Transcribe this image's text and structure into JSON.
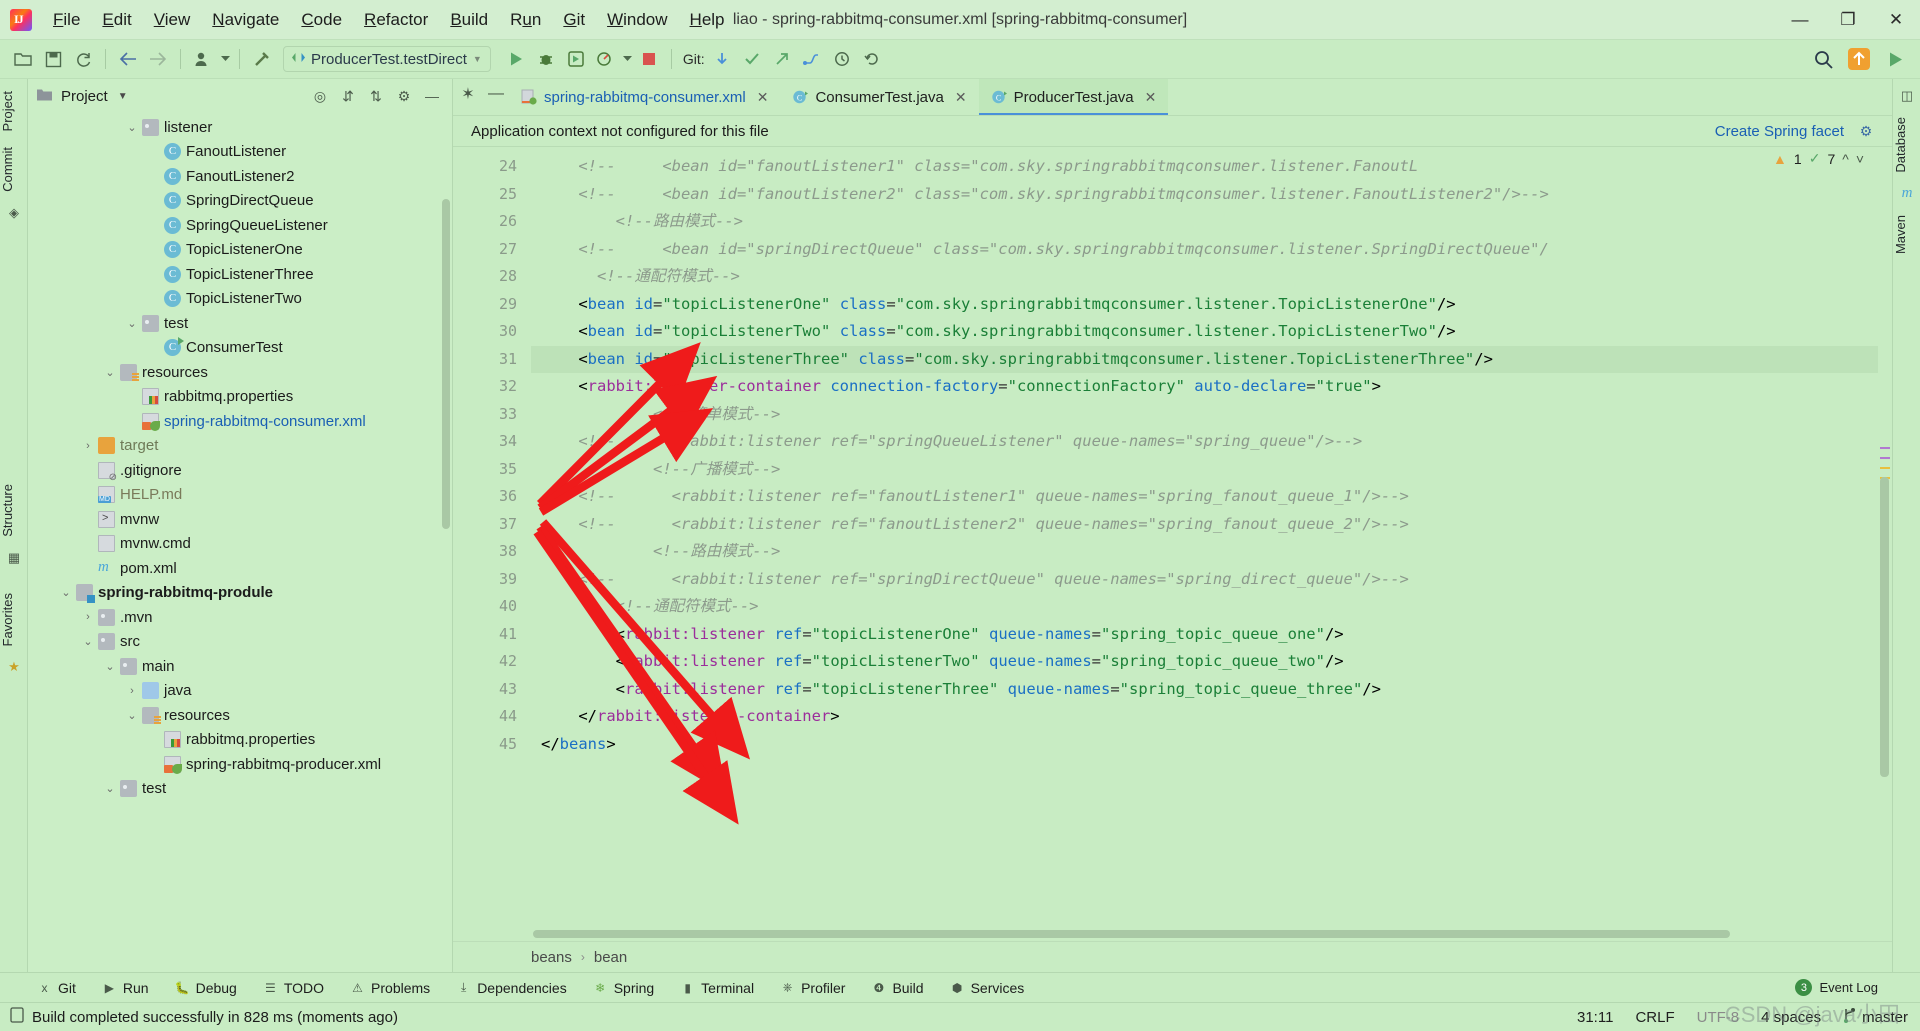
{
  "window": {
    "title": "liao - spring-rabbitmq-consumer.xml [spring-rabbitmq-consumer]",
    "minimize": "—",
    "maximize": "❐",
    "close": "✕"
  },
  "menubar": {
    "items": [
      "File",
      "Edit",
      "View",
      "Navigate",
      "Code",
      "Refactor",
      "Build",
      "Run",
      "Git",
      "Window",
      "Help"
    ]
  },
  "toolbar": {
    "run_config": "ProducerTest.testDirect",
    "git_label": "Git:"
  },
  "left_strip": {
    "tabs": [
      "Project",
      "Commit",
      "Structure",
      "Favorites"
    ]
  },
  "right_strip": {
    "tabs": [
      "Database",
      "Maven"
    ]
  },
  "project_panel": {
    "title": "Project",
    "tree": [
      {
        "indent": 4,
        "twisty": "⌄",
        "icon": "folder",
        "label": "listener",
        "style": ""
      },
      {
        "indent": 5,
        "twisty": "",
        "icon": "cls",
        "label": "FanoutListener",
        "style": ""
      },
      {
        "indent": 5,
        "twisty": "",
        "icon": "cls",
        "label": "FanoutListener2",
        "style": ""
      },
      {
        "indent": 5,
        "twisty": "",
        "icon": "cls",
        "label": "SpringDirectQueue",
        "style": ""
      },
      {
        "indent": 5,
        "twisty": "",
        "icon": "cls",
        "label": "SpringQueueListener",
        "style": ""
      },
      {
        "indent": 5,
        "twisty": "",
        "icon": "cls",
        "label": "TopicListenerOne",
        "style": ""
      },
      {
        "indent": 5,
        "twisty": "",
        "icon": "cls",
        "label": "TopicListenerThree",
        "style": ""
      },
      {
        "indent": 5,
        "twisty": "",
        "icon": "cls",
        "label": "TopicListenerTwo",
        "style": ""
      },
      {
        "indent": 4,
        "twisty": "⌄",
        "icon": "folder",
        "label": "test",
        "style": ""
      },
      {
        "indent": 5,
        "twisty": "",
        "icon": "cls-run",
        "label": "ConsumerTest",
        "style": ""
      },
      {
        "indent": 3,
        "twisty": "⌄",
        "icon": "folder-src",
        "label": "resources",
        "style": ""
      },
      {
        "indent": 4,
        "twisty": "",
        "icon": "props",
        "label": "rabbitmq.properties",
        "style": ""
      },
      {
        "indent": 4,
        "twisty": "",
        "icon": "spring",
        "label": "spring-rabbitmq-consumer.xml",
        "style": "sel"
      },
      {
        "indent": 2,
        "twisty": "›",
        "icon": "folder-orange",
        "label": "target",
        "style": "dim"
      },
      {
        "indent": 2,
        "twisty": "",
        "icon": "git",
        "label": ".gitignore",
        "style": ""
      },
      {
        "indent": 2,
        "twisty": "",
        "icon": "md",
        "label": "HELP.md",
        "style": "dim2"
      },
      {
        "indent": 2,
        "twisty": "",
        "icon": "sh",
        "label": "mvnw",
        "style": ""
      },
      {
        "indent": 2,
        "twisty": "",
        "icon": "file",
        "label": "mvnw.cmd",
        "style": ""
      },
      {
        "indent": 2,
        "twisty": "",
        "icon": "mvn",
        "label": "pom.xml",
        "style": ""
      },
      {
        "indent": 1,
        "twisty": "⌄",
        "icon": "mod",
        "label": "spring-rabbitmq-produle",
        "style": "bold"
      },
      {
        "indent": 2,
        "twisty": "›",
        "icon": "folder",
        "label": ".mvn",
        "style": ""
      },
      {
        "indent": 2,
        "twisty": "⌄",
        "icon": "folder",
        "label": "src",
        "style": ""
      },
      {
        "indent": 3,
        "twisty": "⌄",
        "icon": "folder",
        "label": "main",
        "style": ""
      },
      {
        "indent": 4,
        "twisty": "›",
        "icon": "folder-blue",
        "label": "java",
        "style": ""
      },
      {
        "indent": 4,
        "twisty": "⌄",
        "icon": "folder-src",
        "label": "resources",
        "style": ""
      },
      {
        "indent": 5,
        "twisty": "",
        "icon": "props",
        "label": "rabbitmq.properties",
        "style": ""
      },
      {
        "indent": 5,
        "twisty": "",
        "icon": "spring",
        "label": "spring-rabbitmq-producer.xml",
        "style": ""
      },
      {
        "indent": 3,
        "twisty": "⌄",
        "icon": "folder",
        "label": "test",
        "style": ""
      }
    ]
  },
  "editor": {
    "tabs": [
      {
        "label": "spring-rabbitmq-consumer.xml",
        "icon": "spring",
        "active": true,
        "style": "blue"
      },
      {
        "label": "ConsumerTest.java",
        "icon": "cls-run",
        "active": false,
        "style": ""
      },
      {
        "label": "ProducerTest.java",
        "icon": "cls-run",
        "active": true,
        "style": ""
      }
    ],
    "close_glyph": "✕",
    "notification": "Application context not configured for this file",
    "create_facet_link": "Create Spring facet",
    "inspection_warn_count": "1",
    "inspection_ok_count": "7",
    "breadcrumb": [
      "beans",
      "bean"
    ],
    "first_line_number": 24,
    "lines": [
      {
        "n": 24,
        "fold": "",
        "hl": false,
        "tokens": [
          {
            "t": "cmt",
            "v": "    <!--     <bean id=\"fanoutListener1\" class=\"com.sky.springrabbitmqconsumer.listener.FanoutL"
          }
        ]
      },
      {
        "n": 25,
        "fold": "▸",
        "hl": false,
        "tokens": [
          {
            "t": "cmt",
            "v": "    <!--     <bean id=\"fanoutListener2\" class=\"com.sky.springrabbitmqconsumer.listener.FanoutListener2\"/>-->"
          }
        ]
      },
      {
        "n": 26,
        "fold": "",
        "hl": false,
        "tokens": [
          {
            "t": "cmt",
            "v": "        <!--路由模式-->"
          }
        ]
      },
      {
        "n": 27,
        "fold": "▸",
        "hl": false,
        "tokens": [
          {
            "t": "cmt",
            "v": "    <!--     <bean id=\"springDirectQueue\" class=\"com.sky.springrabbitmqconsumer.listener.SpringDirectQueue\"/"
          }
        ]
      },
      {
        "n": 28,
        "fold": "",
        "hl": false,
        "tokens": [
          {
            "t": "cmt",
            "v": "      <!--通配符模式-->"
          }
        ]
      },
      {
        "n": 29,
        "fold": "",
        "hl": false,
        "tokens": [
          {
            "t": "tag",
            "v": "    <"
          },
          {
            "t": "tagname",
            "v": "bean"
          },
          {
            "t": "plain",
            "v": " "
          },
          {
            "t": "attr",
            "v": "id"
          },
          {
            "t": "eq",
            "v": "="
          },
          {
            "t": "str",
            "v": "\"topicListenerOne\""
          },
          {
            "t": "plain",
            "v": " "
          },
          {
            "t": "attr",
            "v": "class"
          },
          {
            "t": "eq",
            "v": "="
          },
          {
            "t": "str",
            "v": "\"com.sky.springrabbitmqconsumer.listener.TopicListenerOne\""
          },
          {
            "t": "tag",
            "v": "/>"
          }
        ]
      },
      {
        "n": 30,
        "fold": "",
        "hl": false,
        "tokens": [
          {
            "t": "tag",
            "v": "    <"
          },
          {
            "t": "tagname",
            "v": "bean"
          },
          {
            "t": "plain",
            "v": " "
          },
          {
            "t": "attr",
            "v": "id"
          },
          {
            "t": "eq",
            "v": "="
          },
          {
            "t": "str",
            "v": "\"topicListenerTwo\""
          },
          {
            "t": "plain",
            "v": " "
          },
          {
            "t": "attr",
            "v": "class"
          },
          {
            "t": "eq",
            "v": "="
          },
          {
            "t": "str",
            "v": "\"com.sky.springrabbitmqconsumer.listener.TopicListenerTwo\""
          },
          {
            "t": "tag",
            "v": "/>"
          }
        ]
      },
      {
        "n": 31,
        "fold": "",
        "hl": true,
        "tokens": [
          {
            "t": "tag",
            "v": "    <"
          },
          {
            "t": "tagname",
            "v": "bean"
          },
          {
            "t": "plain",
            "v": " "
          },
          {
            "t": "attr",
            "v": "id"
          },
          {
            "t": "eq",
            "v": "="
          },
          {
            "t": "str",
            "v": "\"topicListenerThree\""
          },
          {
            "t": "plain",
            "v": " "
          },
          {
            "t": "attr",
            "v": "class"
          },
          {
            "t": "eq",
            "v": "="
          },
          {
            "t": "str",
            "v": "\"com.sky.springrabbitmqconsumer.listener.TopicListenerThree\""
          },
          {
            "t": "tag",
            "v": "/>"
          }
        ]
      },
      {
        "n": 32,
        "fold": "",
        "hl": false,
        "tokens": [
          {
            "t": "tag",
            "v": "    <"
          },
          {
            "t": "tagname-ns",
            "v": "rabbit:listener-container"
          },
          {
            "t": "plain",
            "v": " "
          },
          {
            "t": "attr",
            "v": "connection-factory"
          },
          {
            "t": "eq",
            "v": "="
          },
          {
            "t": "str",
            "v": "\"connectionFactory\""
          },
          {
            "t": "plain",
            "v": " "
          },
          {
            "t": "attr",
            "v": "auto-declare"
          },
          {
            "t": "eq",
            "v": "="
          },
          {
            "t": "str",
            "v": "\"true\""
          },
          {
            "t": "tag",
            "v": ">"
          }
        ]
      },
      {
        "n": 33,
        "fold": "",
        "hl": false,
        "tokens": [
          {
            "t": "cmt",
            "v": "            <!--简单模式-->"
          }
        ]
      },
      {
        "n": 34,
        "fold": "▸",
        "hl": false,
        "tokens": [
          {
            "t": "cmt",
            "v": "    <!--      <rabbit:listener ref=\"springQueueListener\" queue-names=\"spring_queue\"/>-->"
          }
        ]
      },
      {
        "n": 35,
        "fold": "",
        "hl": false,
        "tokens": [
          {
            "t": "cmt",
            "v": "            <!--广播模式-->"
          }
        ]
      },
      {
        "n": 36,
        "fold": "",
        "hl": false,
        "tokens": [
          {
            "t": "cmt",
            "v": "    <!--      <rabbit:listener ref=\"fanoutListener1\" queue-names=\"spring_fanout_queue_1\"/>-->"
          }
        ]
      },
      {
        "n": 37,
        "fold": "",
        "hl": false,
        "tokens": [
          {
            "t": "cmt",
            "v": "    <!--      <rabbit:listener ref=\"fanoutListener2\" queue-names=\"spring_fanout_queue_2\"/>-->"
          }
        ]
      },
      {
        "n": 38,
        "fold": "",
        "hl": false,
        "tokens": [
          {
            "t": "cmt",
            "v": "            <!--路由模式-->"
          }
        ]
      },
      {
        "n": 39,
        "fold": "▸",
        "hl": false,
        "tokens": [
          {
            "t": "cmt",
            "v": "    <!--      <rabbit:listener ref=\"springDirectQueue\" queue-names=\"spring_direct_queue\"/>-->"
          }
        ]
      },
      {
        "n": 40,
        "fold": "",
        "hl": false,
        "tokens": [
          {
            "t": "cmt",
            "v": "        <!--通配符模式-->"
          }
        ]
      },
      {
        "n": 41,
        "fold": "",
        "hl": false,
        "tokens": [
          {
            "t": "tag",
            "v": "        <"
          },
          {
            "t": "tagname-ns",
            "v": "rabbit:listener"
          },
          {
            "t": "plain",
            "v": " "
          },
          {
            "t": "attr",
            "v": "ref"
          },
          {
            "t": "eq",
            "v": "="
          },
          {
            "t": "str",
            "v": "\"topicListenerOne\""
          },
          {
            "t": "plain",
            "v": " "
          },
          {
            "t": "attr",
            "v": "queue-names"
          },
          {
            "t": "eq",
            "v": "="
          },
          {
            "t": "str",
            "v": "\"spring_topic_queue_one\""
          },
          {
            "t": "tag",
            "v": "/>"
          }
        ]
      },
      {
        "n": 42,
        "fold": "",
        "hl": false,
        "tokens": [
          {
            "t": "tag",
            "v": "        <"
          },
          {
            "t": "tagname-ns",
            "v": "rabbit:listener"
          },
          {
            "t": "plain",
            "v": " "
          },
          {
            "t": "attr",
            "v": "ref"
          },
          {
            "t": "eq",
            "v": "="
          },
          {
            "t": "str",
            "v": "\"topicListenerTwo\""
          },
          {
            "t": "plain",
            "v": " "
          },
          {
            "t": "attr",
            "v": "queue-names"
          },
          {
            "t": "eq",
            "v": "="
          },
          {
            "t": "str",
            "v": "\"spring_topic_queue_two\""
          },
          {
            "t": "tag",
            "v": "/>"
          }
        ]
      },
      {
        "n": 43,
        "fold": "",
        "hl": false,
        "tokens": [
          {
            "t": "tag",
            "v": "        <"
          },
          {
            "t": "tagname-ns",
            "v": "rabbit:listener"
          },
          {
            "t": "plain",
            "v": " "
          },
          {
            "t": "attr",
            "v": "ref"
          },
          {
            "t": "eq",
            "v": "="
          },
          {
            "t": "str",
            "v": "\"topicListenerThree\""
          },
          {
            "t": "plain",
            "v": " "
          },
          {
            "t": "attr",
            "v": "queue-names"
          },
          {
            "t": "eq",
            "v": "="
          },
          {
            "t": "str",
            "v": "\"spring_topic_queue_three\""
          },
          {
            "t": "tag",
            "v": "/>"
          }
        ]
      },
      {
        "n": 44,
        "fold": "",
        "hl": false,
        "tokens": [
          {
            "t": "tag",
            "v": "    </"
          },
          {
            "t": "tagname-ns",
            "v": "rabbit:listener-container"
          },
          {
            "t": "tag",
            "v": ">"
          }
        ]
      },
      {
        "n": 45,
        "fold": "",
        "hl": false,
        "tokens": [
          {
            "t": "tag",
            "v": "</"
          },
          {
            "t": "tagname",
            "v": "beans"
          },
          {
            "t": "tag",
            "v": ">"
          }
        ]
      }
    ]
  },
  "bottom_bar": {
    "items": [
      {
        "label": "Git",
        "icon": "branch-icon"
      },
      {
        "label": "Run",
        "icon": "play-icon"
      },
      {
        "label": "Debug",
        "icon": "bug-icon"
      },
      {
        "label": "TODO",
        "icon": "list-icon"
      },
      {
        "label": "Problems",
        "icon": "warning-icon"
      },
      {
        "label": "Dependencies",
        "icon": "layers-icon"
      },
      {
        "label": "Spring",
        "icon": "leaf-icon"
      },
      {
        "label": "Terminal",
        "icon": "terminal-icon"
      },
      {
        "label": "Profiler",
        "icon": "gauge-icon"
      },
      {
        "label": "Build",
        "icon": "hammer-icon"
      },
      {
        "label": "Services",
        "icon": "services-icon"
      }
    ],
    "event_log": "Event Log",
    "event_log_count": "3"
  },
  "status_bar": {
    "message": "Build completed successfully in 828 ms (moments ago)",
    "caret": "31:11",
    "line_sep": "CRLF",
    "encoding": "UTF-8",
    "indent": "4 spaces",
    "branch": "master"
  },
  "watermark": "CSDN @java小田"
}
